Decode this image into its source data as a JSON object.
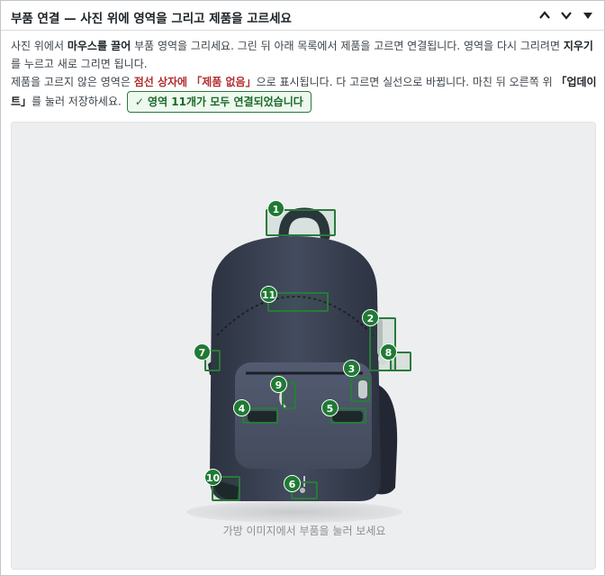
{
  "panel": {
    "title": "부품 연결 — 사진 위에 영역을 그리고 제품을 고르세요"
  },
  "intro": {
    "p1": "사진 위에서 ",
    "p1_bold": "마우스를 끌어",
    "p2": " 부품 영역을 그리세요. 그린 뒤 아래 목록에서 제품을 고르면 연결됩니다. 영역을 다시 그리려면 ",
    "p2_bold": "지우기",
    "p3": "를 누르고 새로 그리면 됩니다.",
    "p4": "제품을 고르지 않은 영역은 ",
    "p4_red": "점선 상자에 「제품 없음」",
    "p5": "으로 표시됩니다. 다 고르면 실선으로 바뀝니다. 마친 뒤 오른쪽 위 ",
    "p5_bold": "「업데이트」",
    "p6": "를 눌러 저장하세요.",
    "status": "✓ 영역 11개가 모두 연결되었습니다"
  },
  "canvas": {
    "hint": "가방 이미지에서 부품을 눌러 보세요"
  },
  "regions": [
    {
      "n": "1"
    },
    {
      "n": "2"
    },
    {
      "n": "3"
    },
    {
      "n": "4"
    },
    {
      "n": "5"
    },
    {
      "n": "6"
    },
    {
      "n": "7"
    },
    {
      "n": "8"
    },
    {
      "n": "9"
    },
    {
      "n": "10"
    },
    {
      "n": "11"
    }
  ],
  "colors": {
    "accent": "#1f7a34",
    "alert": "#b32d2e",
    "bag_body": "#3a4152"
  }
}
